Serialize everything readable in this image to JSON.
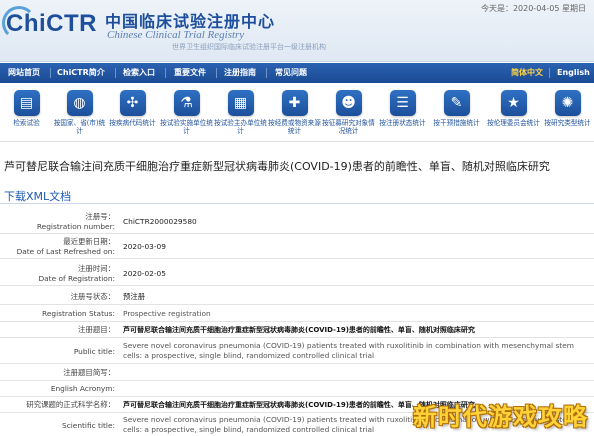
{
  "header": {
    "logo": "ChiCTR",
    "title_cn": "中国临床试验注册中心",
    "title_en": "Chinese Clinical Trial Registry",
    "subtitle": "世界卫生组织国际临床试验注册平台一级注册机构",
    "date": "今天是：2020-04-05 星期日"
  },
  "nav": {
    "items": [
      "网站首页",
      "ChiCTR简介",
      "检索入口",
      "重要文件",
      "注册指南",
      "常见问题"
    ],
    "lang_zh": "简体中文",
    "lang_en": "English"
  },
  "icons": [
    {
      "icon": "search-icon",
      "glyph": "▤",
      "label": "检索试验"
    },
    {
      "icon": "world-map-icon",
      "glyph": "◍",
      "label": "按国家、省(市)统计"
    },
    {
      "icon": "dna-icon",
      "glyph": "✣",
      "label": "按疾病代码统计"
    },
    {
      "icon": "flask-icon",
      "glyph": "⚗",
      "label": "按试验实施单位统计"
    },
    {
      "icon": "document-icon",
      "glyph": "▦",
      "label": "按试验主办单位统计"
    },
    {
      "icon": "medical-kit-icon",
      "glyph": "✚",
      "label": "按经费或物资来源统计"
    },
    {
      "icon": "people-icon",
      "glyph": "☻",
      "label": "按征募研究对象情况统计"
    },
    {
      "icon": "registration-status-icon",
      "glyph": "☰",
      "label": "按注册状态统计"
    },
    {
      "icon": "syringe-icon",
      "glyph": "✎",
      "label": "按干预措施统计"
    },
    {
      "icon": "ethics-star-icon",
      "glyph": "★",
      "label": "按伦理委员会统计"
    },
    {
      "icon": "virus-icon",
      "glyph": "✺",
      "label": "按研究类型统计"
    }
  ],
  "page_title": "芦可替尼联合输注间充质干细胞治疗重症新型冠状病毒肺炎(COVID-19)患者的前瞻性、单盲、随机对照临床研究",
  "xml_link": "下载XML文档",
  "details": [
    {
      "label_cn": "注册号：",
      "label_en": "Registration number:",
      "value": "ChiCTR2000029580",
      "style": ""
    },
    {
      "label_cn": "最近更新日期：",
      "label_en": "Date of Last Refreshed on:",
      "value": "2020-03-09",
      "style": ""
    },
    {
      "label_cn": "注册时间：",
      "label_en": "Date of Registration:",
      "value": "2020-02-05",
      "style": ""
    },
    {
      "label_cn": "注册号状态：",
      "label_en": "",
      "value": "预注册",
      "style": ""
    },
    {
      "label_cn": "",
      "label_en": "Registration Status:",
      "value": "Prospective registration",
      "style": "en"
    },
    {
      "label_cn": "注册题目：",
      "label_en": "",
      "value": "芦可替尼联合输注间充质干细胞治疗重症新型冠状病毒肺炎(COVID-19)患者的前瞻性、单盲、随机对照临床研究",
      "style": "bold"
    },
    {
      "label_cn": "",
      "label_en": "Public title:",
      "value": "Severe novel coronavirus pneumonia (COVID-19) patients treated with ruxolitinib in combination with mesenchymal stem cells: a prospective, single blind, randomized controlled clinical trial",
      "style": "en"
    },
    {
      "label_cn": "注册题目简写：",
      "label_en": "",
      "value": "",
      "style": ""
    },
    {
      "label_cn": "",
      "label_en": "English Acronym:",
      "value": "",
      "style": ""
    },
    {
      "label_cn": "研究课题的正式科学名称：",
      "label_en": "",
      "value": "芦可替尼联合输注间充质干细胞治疗重症新型冠状病毒肺炎(COVID-19)患者的前瞻性、单盲、随机对照临床研究",
      "style": "bold"
    },
    {
      "label_cn": "",
      "label_en": "Scientific title:",
      "value": "Severe novel coronavirus pneumonia (COVID-19) patients treated with ruxolitinib in combination with mesenchymal stem cells: a prospective, single blind, randomized controlled clinical trial",
      "style": "en"
    }
  ],
  "watermark": "新时代游戏攻略"
}
